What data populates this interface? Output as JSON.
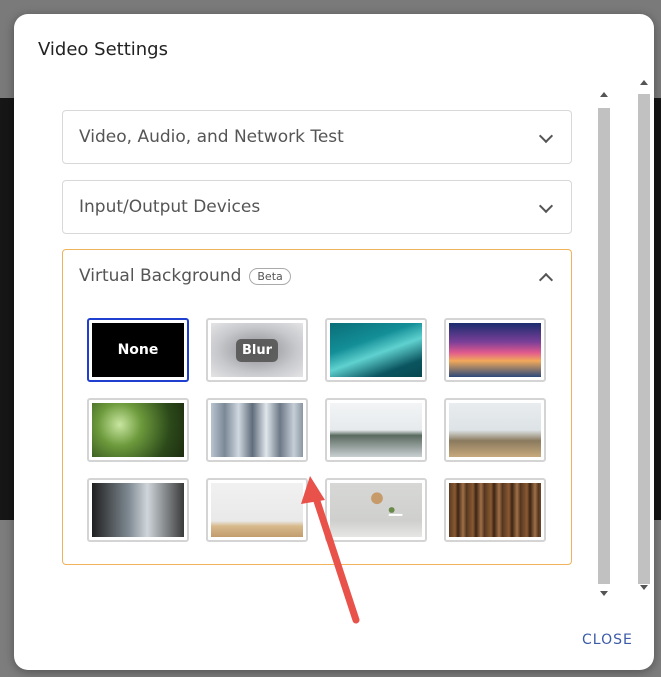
{
  "dialog": {
    "title": "Video Settings",
    "close_label": "CLOSE"
  },
  "accordions": [
    {
      "title": "Video, Audio, and Network Test",
      "expanded": false
    },
    {
      "title": "Input/Output Devices",
      "expanded": false
    },
    {
      "title": "Virtual Background",
      "badge": "Beta",
      "expanded": true
    }
  ],
  "backgrounds": [
    {
      "name": "none",
      "label": "None",
      "selected": true
    },
    {
      "name": "blur",
      "label": "Blur",
      "selected": false
    },
    {
      "name": "aurora",
      "label": "",
      "selected": false
    },
    {
      "name": "sunset",
      "label": "",
      "selected": false
    },
    {
      "name": "trees",
      "label": "",
      "selected": false
    },
    {
      "name": "towers",
      "label": "",
      "selected": false
    },
    {
      "name": "office1",
      "label": "",
      "selected": false
    },
    {
      "name": "office2",
      "label": "",
      "selected": false
    },
    {
      "name": "hall",
      "label": "",
      "selected": false
    },
    {
      "name": "desk",
      "label": "",
      "selected": false
    },
    {
      "name": "clock",
      "label": "",
      "selected": false
    },
    {
      "name": "books",
      "label": "",
      "selected": false
    }
  ],
  "colors": {
    "accent_selected": "#1f3fd0",
    "accordion_active_border": "#f0b25a",
    "close_text": "#3b5aa8",
    "annotation_arrow": "#e8524a"
  }
}
